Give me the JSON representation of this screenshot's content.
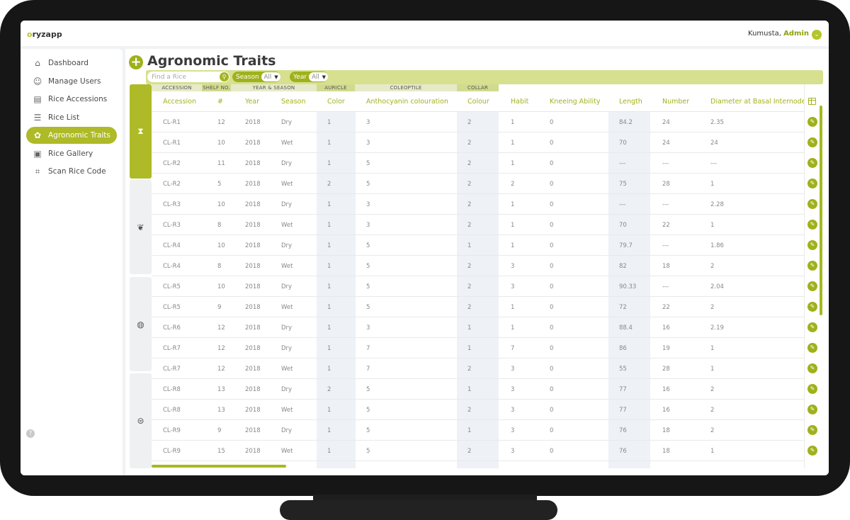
{
  "app": {
    "name_prefix": "",
    "name_o": "o",
    "name_rest": "ryzapp"
  },
  "header": {
    "user_name": "Kumusta,",
    "user_role": "Admin"
  },
  "sidebar": {
    "items": [
      {
        "label": "Dashboard",
        "icon": "dashboard-icon",
        "glyph": "⌂"
      },
      {
        "label": "Manage Users",
        "icon": "users-icon",
        "glyph": "☺"
      },
      {
        "label": "Rice Accessions",
        "icon": "accessions-icon",
        "glyph": "▤"
      },
      {
        "label": "Rice List",
        "icon": "list-icon",
        "glyph": "☰"
      },
      {
        "label": "Agronomic Traits",
        "icon": "traits-icon",
        "glyph": "✿"
      },
      {
        "label": "Rice Gallery",
        "icon": "gallery-icon",
        "glyph": "▣"
      },
      {
        "label": "Scan Rice Code",
        "icon": "scan-icon",
        "glyph": "⌗"
      }
    ],
    "active_index": 4
  },
  "page": {
    "title": "Agronomic Traits"
  },
  "filters": {
    "search_placeholder": "Find a Rice",
    "season_label": "Season",
    "season_value": "All",
    "year_label": "Year",
    "year_value": "All"
  },
  "group_headers": {
    "accession": "ACCESSION",
    "shelf_no": "SHELF NO.",
    "year_season": "YEAR & SEASON",
    "auricle": "AURICLE",
    "coleoptile": "COLEOPTILE",
    "collar": "COLLAR"
  },
  "columns": {
    "accession": "Accession",
    "num": "#",
    "year": "Year",
    "season": "Season",
    "color": "Color",
    "anthocyanin": "Anthocyanin colouration",
    "colour": "Colour",
    "habit": "Habit",
    "kneeing": "Kneeing Ability",
    "length": "Length",
    "number": "Number",
    "diameter": "Diameter at Basal Internode"
  },
  "rows": [
    [
      "CL-R1",
      "12",
      "2018",
      "Dry",
      "1",
      "3",
      "2",
      "1",
      "0",
      "84.2",
      "24",
      "2.35"
    ],
    [
      "CL-R1",
      "10",
      "2018",
      "Wet",
      "1",
      "3",
      "2",
      "1",
      "0",
      "70",
      "24",
      "24"
    ],
    [
      "CL-R2",
      "11",
      "2018",
      "Dry",
      "1",
      "5",
      "2",
      "1",
      "0",
      "---",
      "---",
      "---"
    ],
    [
      "CL-R2",
      "5",
      "2018",
      "Wet",
      "2",
      "5",
      "2",
      "2",
      "0",
      "75",
      "28",
      "1"
    ],
    [
      "CL-R3",
      "10",
      "2018",
      "Dry",
      "1",
      "3",
      "2",
      "1",
      "0",
      "---",
      "---",
      "2.28"
    ],
    [
      "CL-R3",
      "8",
      "2018",
      "Wet",
      "1",
      "3",
      "2",
      "1",
      "0",
      "70",
      "22",
      "1"
    ],
    [
      "CL-R4",
      "10",
      "2018",
      "Dry",
      "1",
      "5",
      "1",
      "1",
      "0",
      "79.7",
      "---",
      "1.86"
    ],
    [
      "CL-R4",
      "8",
      "2018",
      "Wet",
      "1",
      "5",
      "2",
      "3",
      "0",
      "82",
      "18",
      "2"
    ],
    [
      "CL-R5",
      "10",
      "2018",
      "Dry",
      "1",
      "5",
      "2",
      "3",
      "0",
      "90.33",
      "---",
      "2.04"
    ],
    [
      "CL-R5",
      "9",
      "2018",
      "Wet",
      "1",
      "5",
      "2",
      "1",
      "0",
      "72",
      "22",
      "2"
    ],
    [
      "CL-R6",
      "12",
      "2018",
      "Dry",
      "1",
      "3",
      "1",
      "1",
      "0",
      "88.4",
      "16",
      "2.19"
    ],
    [
      "CL-R7",
      "12",
      "2018",
      "Dry",
      "1",
      "7",
      "1",
      "7",
      "0",
      "86",
      "19",
      "1"
    ],
    [
      "CL-R7",
      "12",
      "2018",
      "Wet",
      "1",
      "7",
      "2",
      "3",
      "0",
      "55",
      "28",
      "1"
    ],
    [
      "CL-R8",
      "13",
      "2018",
      "Dry",
      "2",
      "5",
      "1",
      "3",
      "0",
      "77",
      "16",
      "2"
    ],
    [
      "CL-R8",
      "13",
      "2018",
      "Wet",
      "1",
      "5",
      "2",
      "3",
      "0",
      "77",
      "16",
      "2"
    ],
    [
      "CL-R9",
      "9",
      "2018",
      "Dry",
      "1",
      "5",
      "1",
      "3",
      "0",
      "76",
      "18",
      "2"
    ],
    [
      "CL-R9",
      "15",
      "2018",
      "Wet",
      "1",
      "5",
      "2",
      "3",
      "0",
      "76",
      "18",
      "1"
    ]
  ],
  "colors": {
    "accent": "#aeba27",
    "header_text": "#a4b21c",
    "filterbar": "#d6e08e"
  }
}
